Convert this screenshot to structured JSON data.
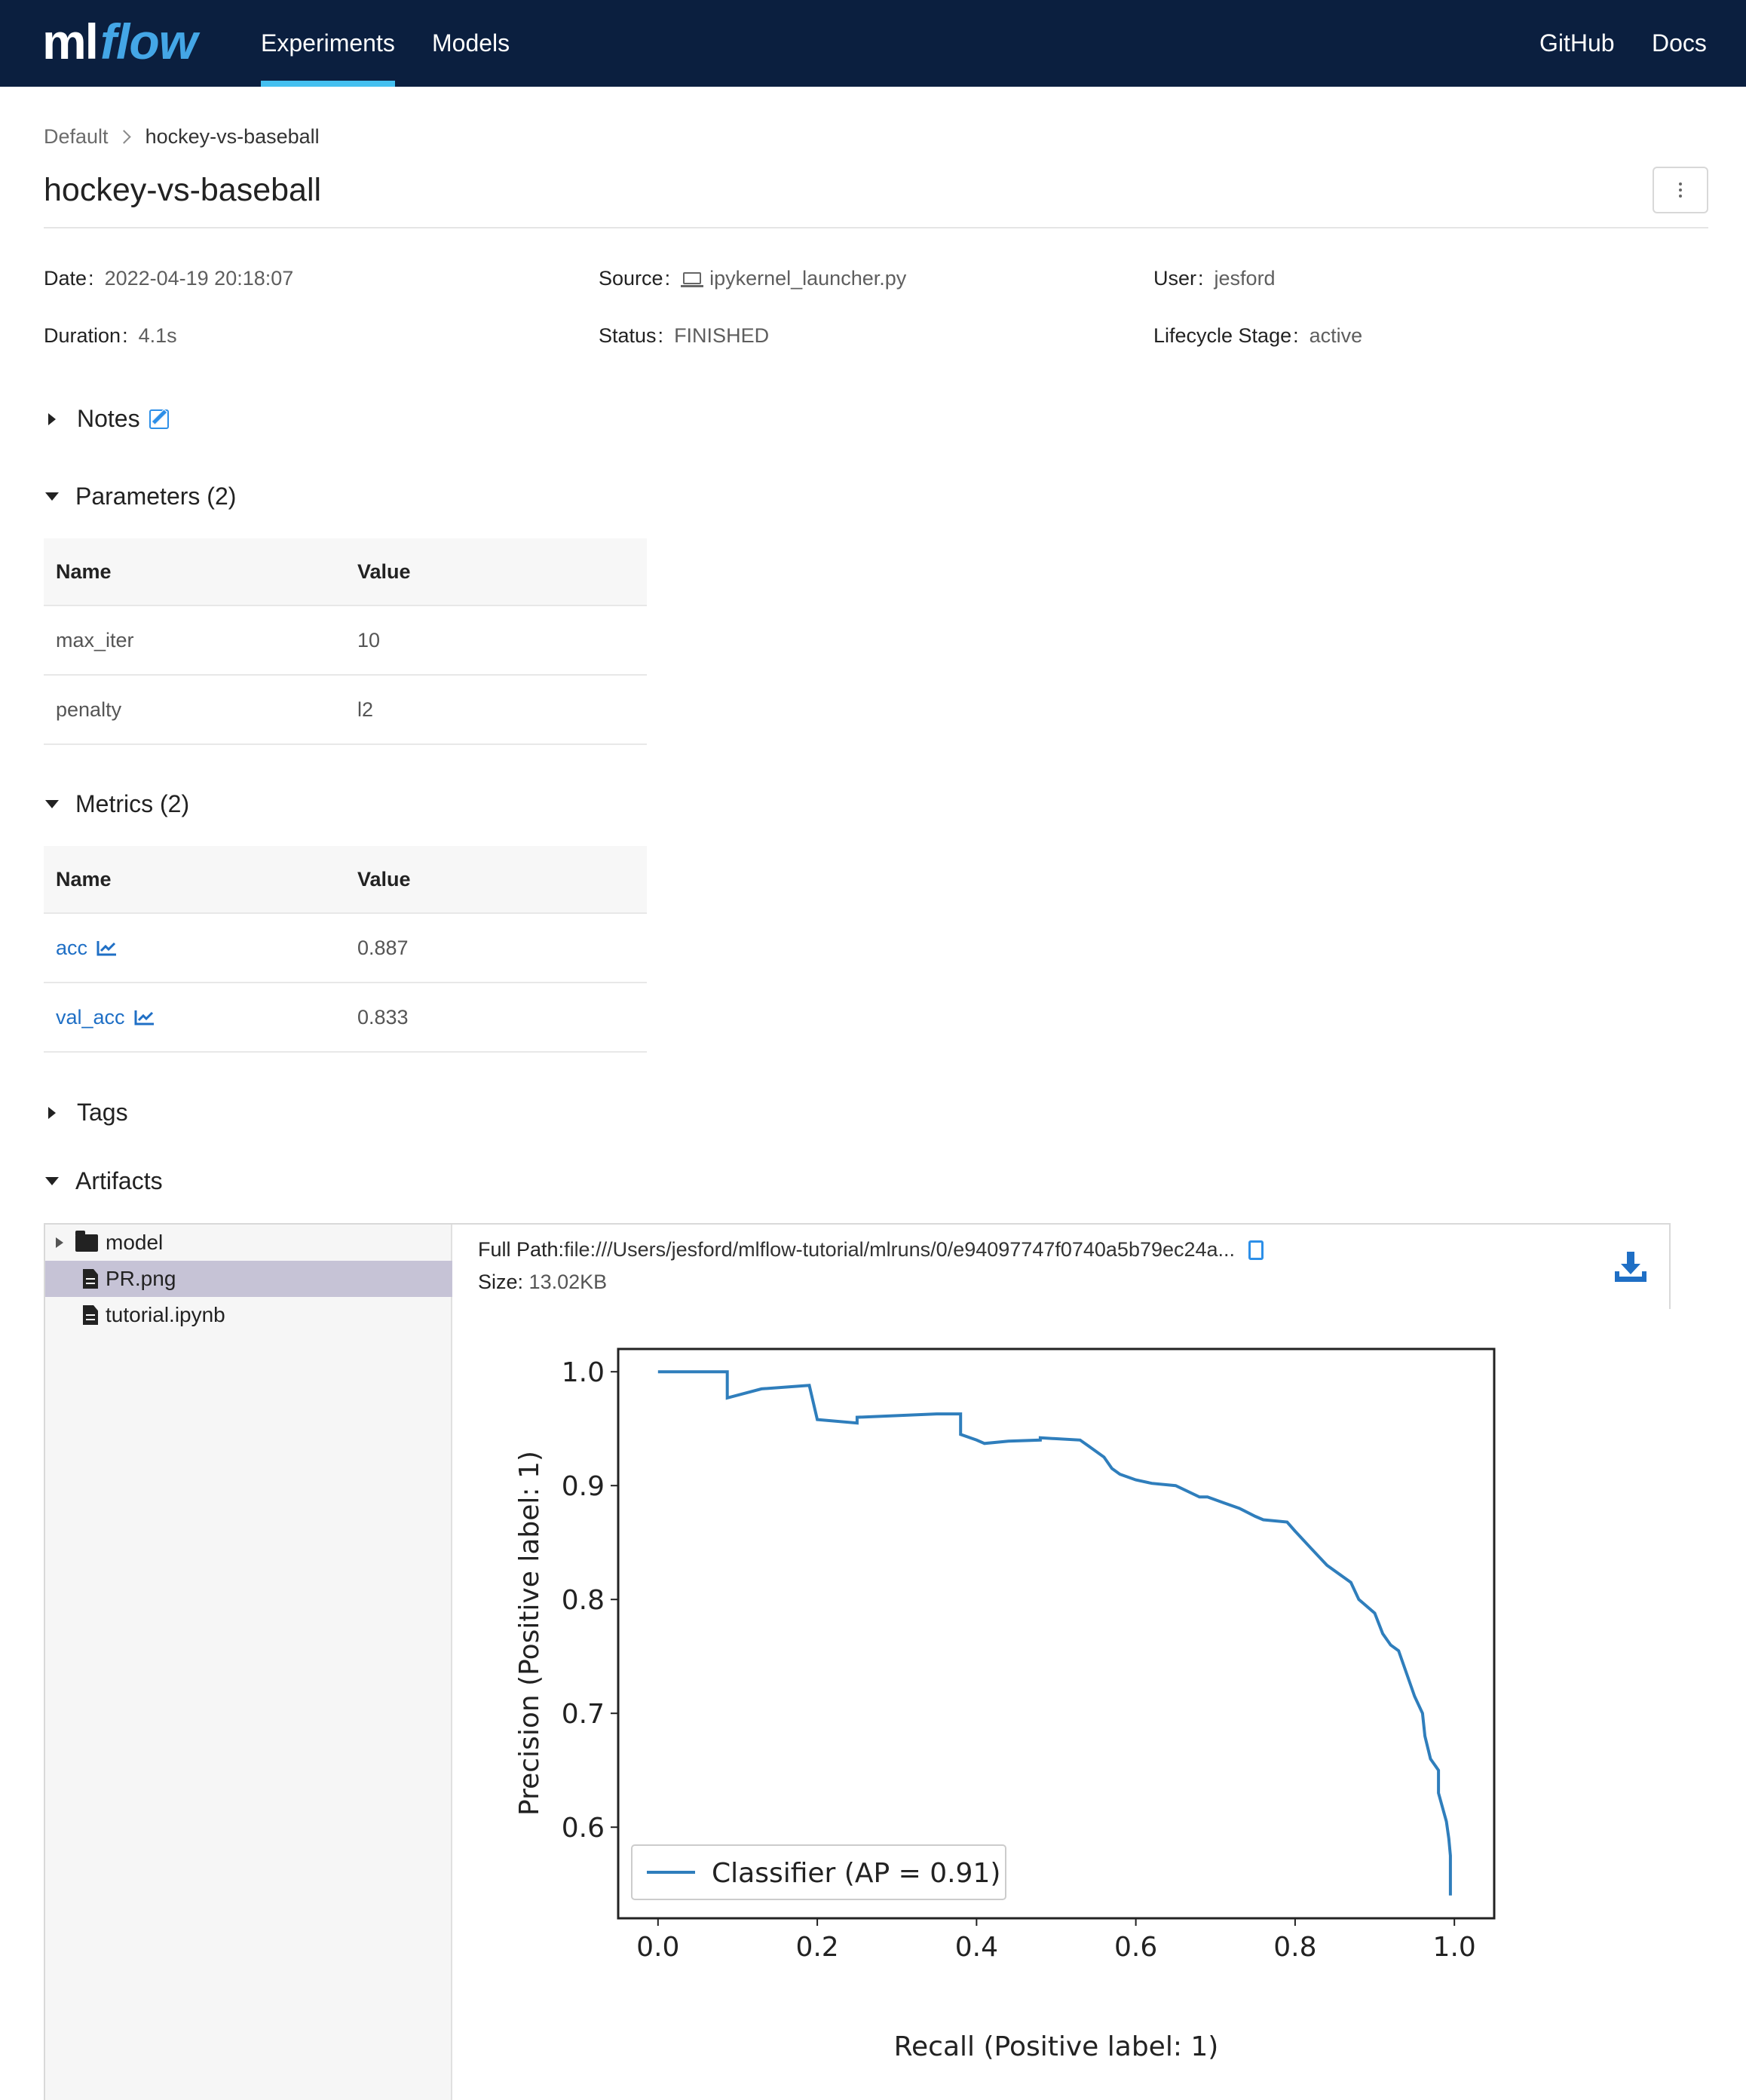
{
  "nav": {
    "logo_ml": "ml",
    "logo_flow": "flow",
    "experiments": "Experiments",
    "models": "Models",
    "github": "GitHub",
    "docs": "Docs"
  },
  "breadcrumb": {
    "root": "Default",
    "current": "hockey-vs-baseball"
  },
  "title": "hockey-vs-baseball",
  "meta": {
    "date_label": "Date",
    "date_value": "2022-04-19 20:18:07",
    "source_label": "Source",
    "source_value": "ipykernel_launcher.py",
    "user_label": "User",
    "user_value": "jesford",
    "duration_label": "Duration",
    "duration_value": "4.1s",
    "status_label": "Status",
    "status_value": "FINISHED",
    "lifecycle_label": "Lifecycle Stage",
    "lifecycle_value": "active",
    "colon": ":"
  },
  "sections": {
    "notes": "Notes",
    "parameters": "Parameters (2)",
    "metrics": "Metrics (2)",
    "tags": "Tags",
    "artifacts": "Artifacts"
  },
  "parameters": {
    "header_name": "Name",
    "header_value": "Value",
    "rows": [
      {
        "name": "max_iter",
        "value": "10"
      },
      {
        "name": "penalty",
        "value": "l2"
      }
    ]
  },
  "metrics": {
    "header_name": "Name",
    "header_value": "Value",
    "rows": [
      {
        "name": "acc",
        "value": "0.887"
      },
      {
        "name": "val_acc",
        "value": "0.833"
      }
    ]
  },
  "artifacts": {
    "tree": [
      {
        "name": "model",
        "type": "folder"
      },
      {
        "name": "PR.png",
        "type": "image-file",
        "selected": true
      },
      {
        "name": "tutorial.ipynb",
        "type": "file"
      }
    ],
    "full_path_label": "Full Path:",
    "full_path_value": "file:///Users/jesford/mlflow-tutorial/mlruns/0/e94097747f0740a5b79ec24a...",
    "size_label": "Size:",
    "size_value": "13.02KB"
  },
  "colors": {
    "nav_bg": "#0b1f3f",
    "accent": "#44c0f0",
    "link": "#1f6fc5",
    "series": "#2f7ebc"
  },
  "chart_data": {
    "type": "line",
    "title": "",
    "xlabel": "Recall (Positive label: 1)",
    "ylabel": "Precision (Positive label: 1)",
    "xlim": [
      -0.05,
      1.05
    ],
    "ylim": [
      0.52,
      1.02
    ],
    "xticks": [
      "0.0",
      "0.2",
      "0.4",
      "0.6",
      "0.8",
      "1.0"
    ],
    "yticks": [
      "0.6",
      "0.7",
      "0.8",
      "0.9",
      "1.0"
    ],
    "legend": "lower-left",
    "series": [
      {
        "name": "Classifier (AP = 0.91)",
        "x": [
          0.0,
          0.087,
          0.087,
          0.13,
          0.19,
          0.2,
          0.2,
          0.25,
          0.25,
          0.35,
          0.38,
          0.38,
          0.4,
          0.41,
          0.44,
          0.48,
          0.48,
          0.53,
          0.54,
          0.56,
          0.57,
          0.58,
          0.6,
          0.62,
          0.65,
          0.68,
          0.69,
          0.71,
          0.73,
          0.75,
          0.76,
          0.79,
          0.8,
          0.82,
          0.84,
          0.86,
          0.87,
          0.88,
          0.9,
          0.91,
          0.92,
          0.93,
          0.94,
          0.95,
          0.96,
          0.963,
          0.97,
          0.98,
          0.98,
          0.99,
          0.993,
          0.995,
          0.995
        ],
        "y": [
          1.0,
          1.0,
          0.977,
          0.985,
          0.988,
          0.958,
          0.958,
          0.955,
          0.96,
          0.963,
          0.963,
          0.945,
          0.94,
          0.937,
          0.939,
          0.94,
          0.942,
          0.94,
          0.935,
          0.925,
          0.915,
          0.91,
          0.905,
          0.902,
          0.9,
          0.89,
          0.89,
          0.885,
          0.88,
          0.873,
          0.87,
          0.868,
          0.86,
          0.845,
          0.83,
          0.82,
          0.815,
          0.8,
          0.788,
          0.77,
          0.76,
          0.755,
          0.735,
          0.715,
          0.7,
          0.68,
          0.66,
          0.65,
          0.63,
          0.605,
          0.59,
          0.575,
          0.54
        ]
      }
    ]
  }
}
